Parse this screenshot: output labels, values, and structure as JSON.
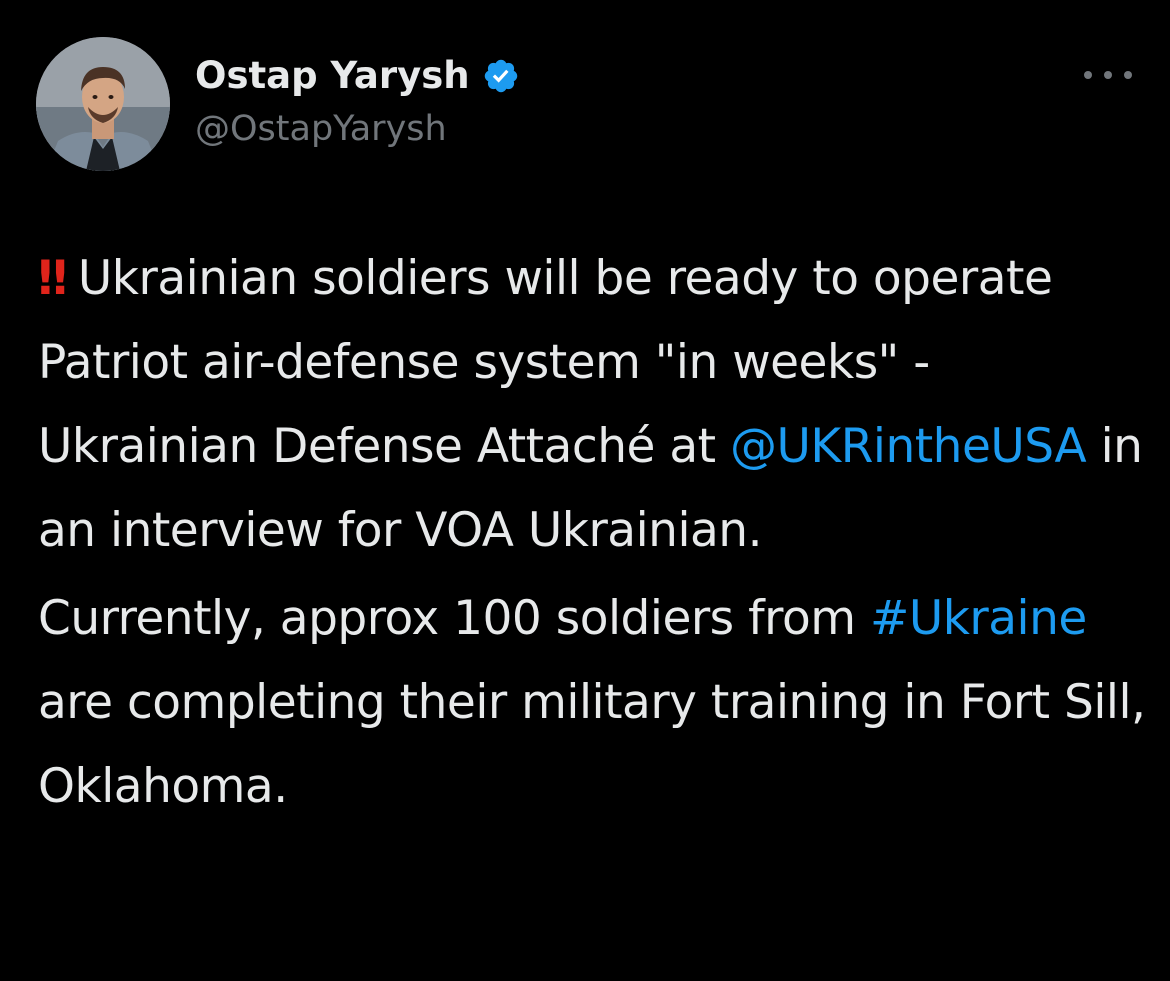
{
  "tweet": {
    "author": {
      "display_name": "Ostap Yarysh",
      "handle": "@OstapYarysh",
      "verified": true,
      "avatar_icon": "user-avatar-photo"
    },
    "more_icon": "ellipsis-icon",
    "paragraph1": {
      "emoji": "‼",
      "text1": " Ukrainian soldiers will be ready to operate Patriot air-defense system \"in weeks\" - Ukrainian Defense Attaché at ",
      "mention": "@UKRintheUSA",
      "text2": " in an interview for VOA Ukrainian."
    },
    "paragraph2": {
      "text1": "Currently, approx 100 soldiers from ",
      "hashtag": "#Ukraine",
      "text2": " are completing their military training in Fort Sill, Oklahoma."
    }
  },
  "colors": {
    "background": "#000000",
    "text": "#e7e9ea",
    "secondary_text": "#71767b",
    "link": "#1d9bf0",
    "emoji_red": "#e0241b",
    "verified_badge": "#1d9bf0"
  }
}
